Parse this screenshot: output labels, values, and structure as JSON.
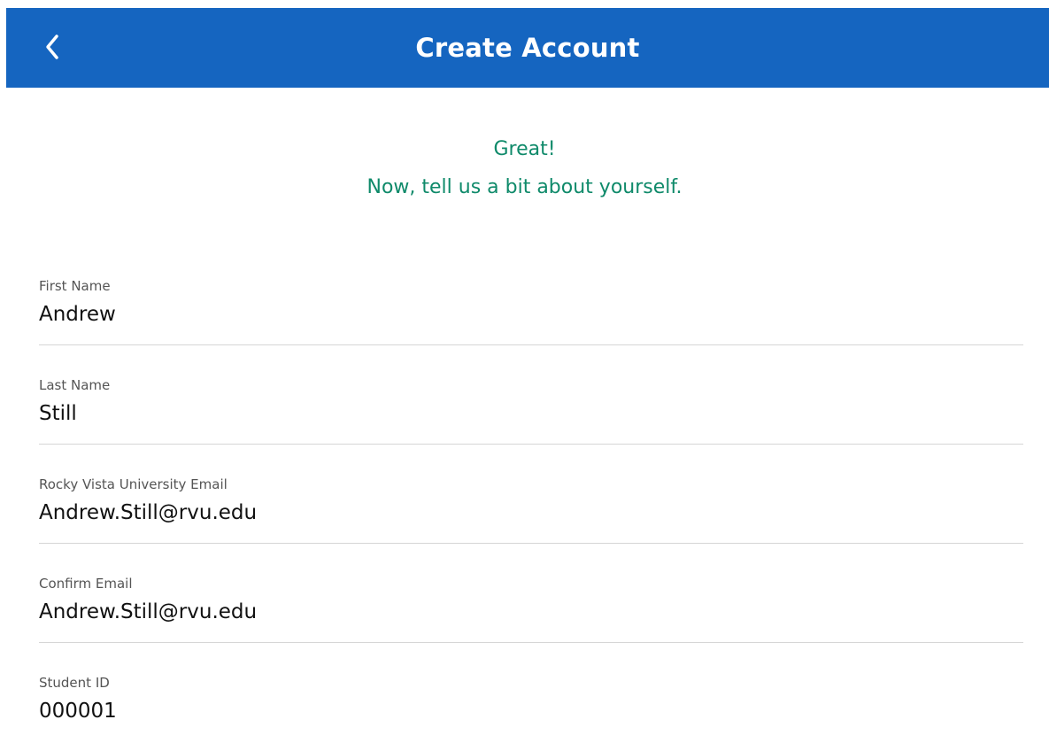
{
  "header": {
    "title": "Create Account",
    "back_icon": "chevron-left-icon",
    "background_color": "#1565c0"
  },
  "intro": {
    "line1": "Great!",
    "line2": "Now, tell us a bit about yourself.",
    "color": "#0f8a6a"
  },
  "form": {
    "fields": [
      {
        "label": "First Name",
        "value": "Andrew"
      },
      {
        "label": "Last Name",
        "value": "Still"
      },
      {
        "label": "Rocky Vista University Email",
        "value": "Andrew.Still@rvu.edu"
      },
      {
        "label": "Confirm Email",
        "value": "Andrew.Still@rvu.edu"
      },
      {
        "label": "Student ID",
        "value": "000001"
      }
    ]
  }
}
